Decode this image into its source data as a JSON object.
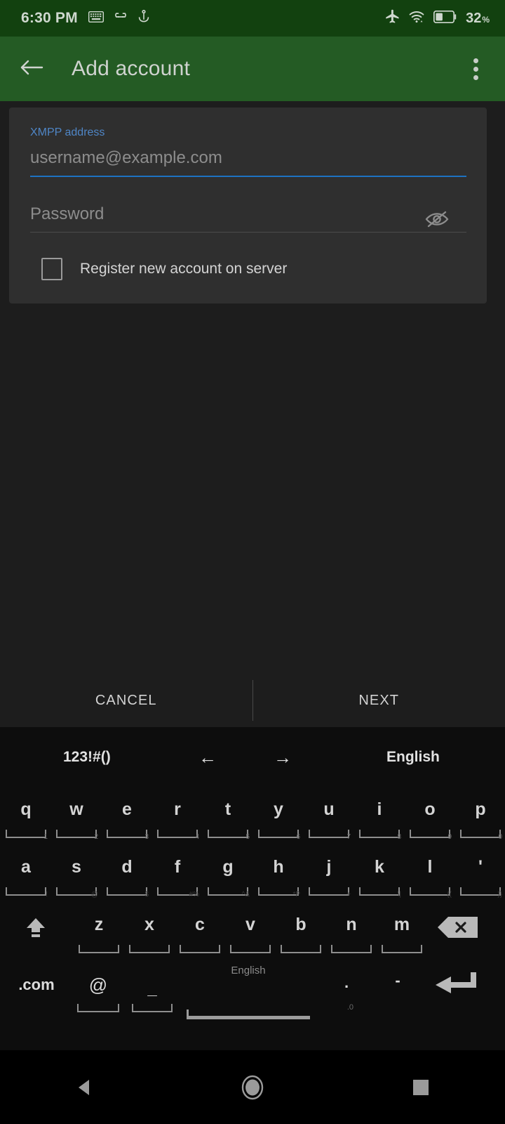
{
  "status_bar": {
    "time": "6:30 PM",
    "left_icons": [
      "keyboard-icon",
      "link-icon",
      "download-anchor-icon"
    ],
    "right_icons": [
      "airplane-mode-icon",
      "wifi-icon",
      "battery-icon"
    ],
    "battery_percent": "32",
    "percent_symbol": "%",
    "background_color": "#12410f"
  },
  "app_bar": {
    "back_icon": "arrow-back-icon",
    "title": "Add account",
    "overflow_icon": "more-vertical-icon",
    "background_color": "#245b24"
  },
  "form": {
    "xmpp_label": "XMPP address",
    "xmpp_value": "",
    "xmpp_placeholder": "username@example.com",
    "xmpp_underline_color": "#1d72c2",
    "password_value": "",
    "password_placeholder": "Password",
    "password_toggle_icon": "eye-off-icon",
    "checkbox_label": "Register new account on server",
    "checkbox_checked": false
  },
  "actions": {
    "cancel_label": "CANCEL",
    "next_label": "NEXT"
  },
  "keyboard": {
    "toolbar": {
      "symbols_label": "123!#()",
      "left_arrow": "←",
      "right_arrow": "→",
      "language_label": "English"
    },
    "row1": [
      {
        "cap": "q",
        "hint": "1"
      },
      {
        "cap": "w",
        "hint": "2"
      },
      {
        "cap": "e",
        "hint": "3"
      },
      {
        "cap": "r",
        "hint": "4"
      },
      {
        "cap": "t",
        "hint": "5"
      },
      {
        "cap": "y",
        "hint": "6"
      },
      {
        "cap": "u",
        "hint": "7"
      },
      {
        "cap": "i",
        "hint": "8"
      },
      {
        "cap": "o",
        "hint": "9"
      },
      {
        "cap": "p",
        "hint": "0"
      }
    ],
    "row2": [
      {
        "cap": "a",
        "hint": "!"
      },
      {
        "cap": "s",
        "hint": "@"
      },
      {
        "cap": "d",
        "hint": "$"
      },
      {
        "cap": "f",
        "hint": "#%"
      },
      {
        "cap": "g",
        "hint": "^&"
      },
      {
        "cap": "h",
        "hint": "*P"
      },
      {
        "cap": "j",
        "hint": "+"
      },
      {
        "cap": "k",
        "hint": "\\|"
      },
      {
        "cap": "l",
        "hint": "{("
      },
      {
        "cap": "'",
        "hint": ")}"
      }
    ],
    "row3": [
      {
        "cap": "z",
        "hint": ""
      },
      {
        "cap": "x",
        "hint": ""
      },
      {
        "cap": "c",
        "hint": ""
      },
      {
        "cap": "v",
        "hint": ""
      },
      {
        "cap": "b",
        "hint": ""
      },
      {
        "cap": "n",
        "hint": ""
      },
      {
        "cap": "m",
        "hint": ""
      }
    ],
    "shift_icon": "shift-icon",
    "backspace_icon": "backspace-icon",
    "row4": {
      "dotcom_label": ".com",
      "at_label": "@",
      "underscore_label": "_",
      "space_label": "English",
      "period_label": ".",
      "period_hint": ".0",
      "dash_label": "-",
      "enter_icon": "enter-icon"
    }
  },
  "nav_bar": {
    "back_icon": "nav-back-icon",
    "home_icon": "nav-home-icon",
    "recents_icon": "nav-recents-icon"
  }
}
